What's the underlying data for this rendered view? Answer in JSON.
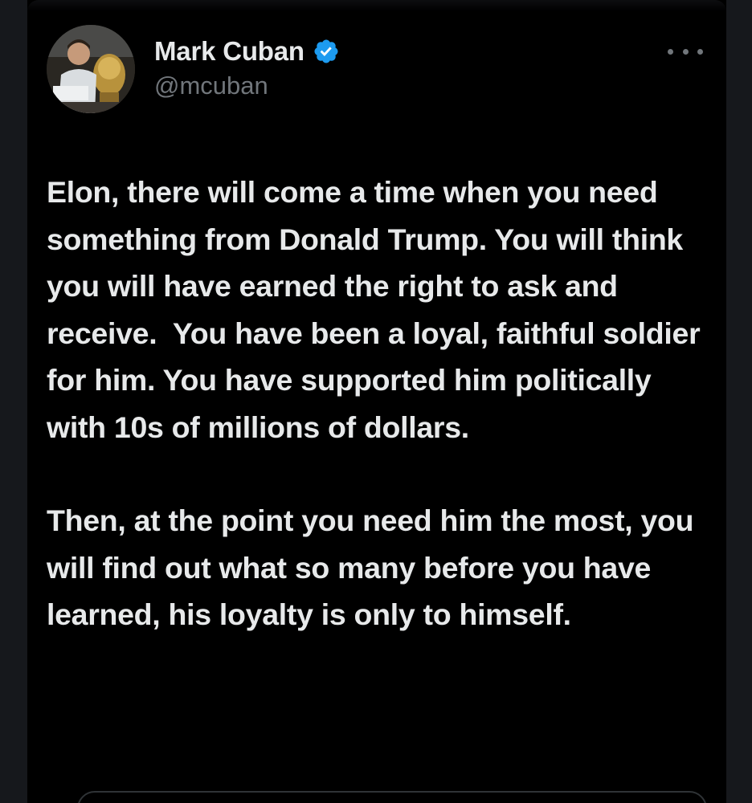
{
  "author": {
    "name": "Mark Cuban",
    "handle": "@mcuban",
    "verified": true,
    "avatar_icon": "profile-photo-avatar"
  },
  "actions": {
    "more_icon": "more-horizontal-icon"
  },
  "tweet": {
    "paragraphs": [
      "Elon, there will come a time when you need something from Donald Trump. You will think you will have earned the right to ask and receive.  You have been a loyal, faithful soldier for him. You have supported him politically with 10s of millions of dollars.",
      "Then, at the point you need him the most, you will find out what so many before you have learned, his loyalty is only to himself."
    ]
  },
  "colors": {
    "background": "#000000",
    "text_primary": "#e7e9ea",
    "text_secondary": "#71767b",
    "verified_blue": "#1d9bf0",
    "border": "#2f3336"
  }
}
